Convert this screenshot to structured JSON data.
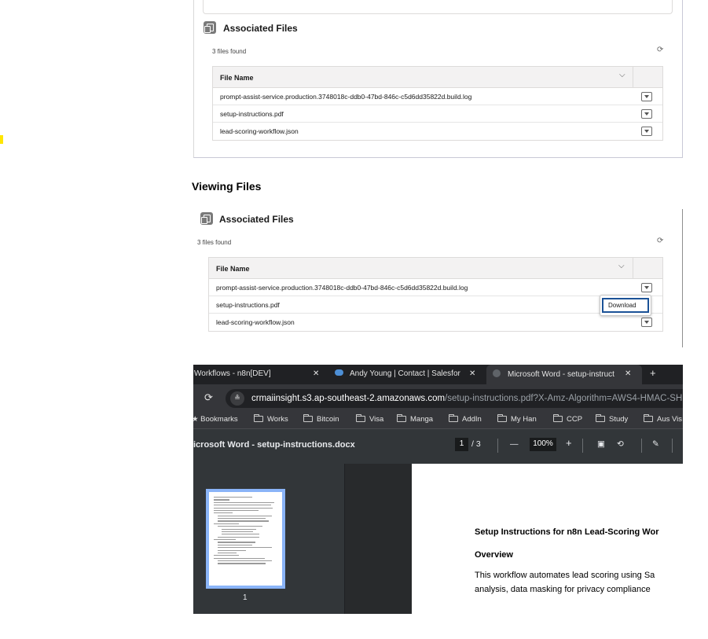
{
  "panel1": {
    "card_title": "Associated Files",
    "files_found": "3 files found",
    "column_header": "File Name",
    "files": [
      "prompt-assist-service.production.3748018c-ddb0-47bd-846c-c5d6dd35822d.build.log",
      "setup-instructions.pdf",
      "lead-scoring-workflow.json"
    ]
  },
  "section_heading": "Viewing Files",
  "panel2": {
    "card_title": "Associated Files",
    "files_found": "3 files found",
    "column_header": "File Name",
    "files": [
      "prompt-assist-service.production.3748018c-ddb0-47bd-846c-c5d6dd35822d.build.log",
      "setup-instructions.pdf",
      "lead-scoring-workflow.json"
    ],
    "dropdown_item": "Download"
  },
  "browser": {
    "tabs": [
      {
        "label": "Workflows - n8n[DEV]"
      },
      {
        "label": "Andy Young | Contact | Salesfor"
      },
      {
        "label": "Microsoft Word - setup-instruct"
      }
    ],
    "new_tab": "+",
    "url_host": "crmaiinsight.s3.ap-southeast-2.amazonaws.com",
    "url_path": "/setup-instructions.pdf?X-Amz-Algorithm=AWS4-HMAC-SH",
    "bookmarks": [
      "Bookmarks",
      "Works",
      "Bitcoin",
      "Visa",
      "Manga",
      "AddIn",
      "My Han",
      "CCP",
      "Study",
      "Aus Vis"
    ],
    "pdf_title": "icrosoft Word - setup-instructions.docx",
    "page_current": "1",
    "page_total": "/ 3",
    "zoom": "100%",
    "thumb_page_number": "1",
    "doc_heading": "Setup Instructions for n8n Lead-Scoring Wor",
    "doc_subheading": "Overview",
    "doc_line1": "This workflow automates lead scoring using Sa",
    "doc_line2": "analysis, data masking for privacy compliance"
  },
  "colors": {
    "marker": "#ffe600",
    "browser_bg": "#202124",
    "toolbar": "#35363a",
    "pdf_toolbar": "#323639",
    "thumb_highlight": "#8ab4f8",
    "focus_blue": "#1b5297"
  }
}
